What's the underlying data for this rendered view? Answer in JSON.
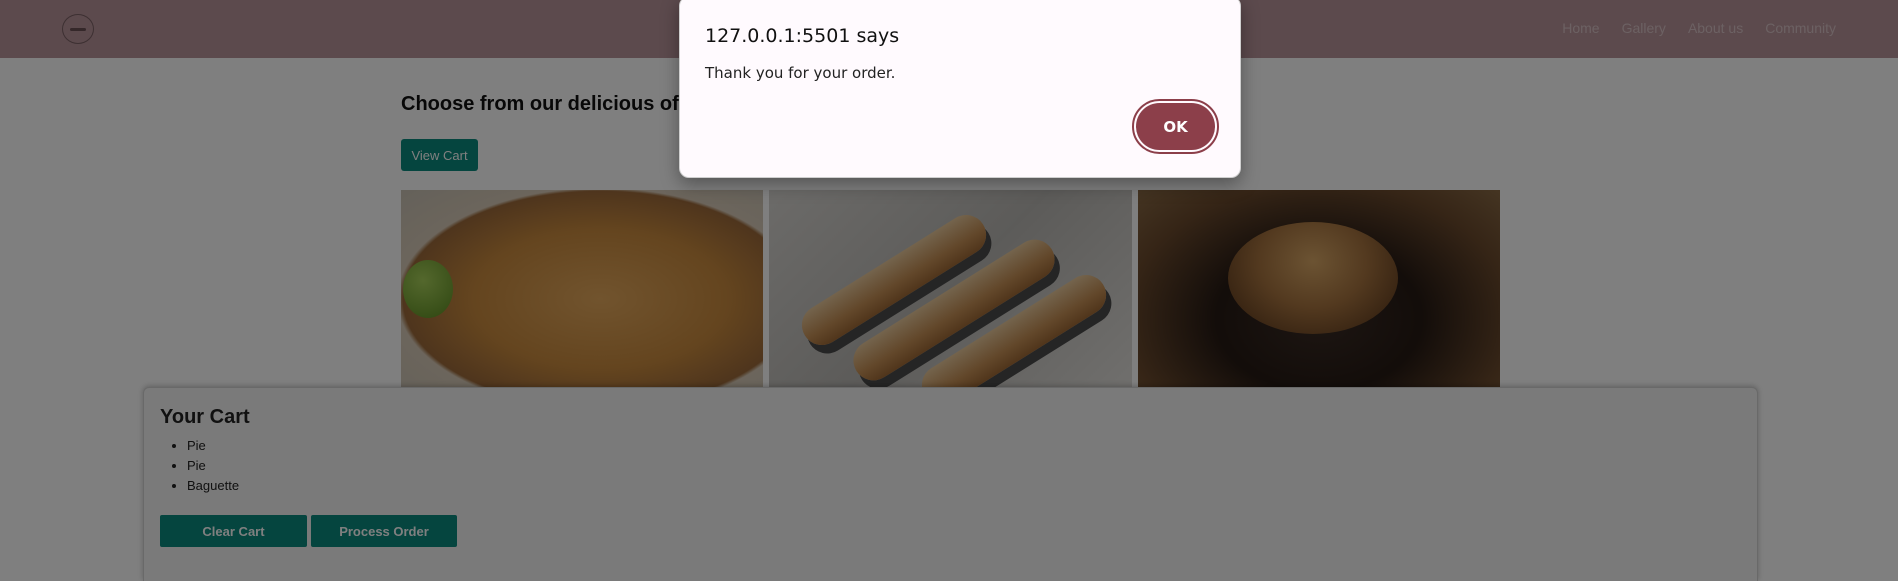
{
  "header": {
    "nav": [
      "Home",
      "Gallery",
      "About us",
      "Community"
    ]
  },
  "main": {
    "title": "Choose from our delicious of",
    "view_cart_label": "View Cart"
  },
  "gallery": {
    "images": [
      "pie-photo",
      "baguette-photo",
      "bread-loaf-photo"
    ]
  },
  "cart": {
    "title": "Your Cart",
    "items": [
      "Pie",
      "Pie",
      "Baguette"
    ],
    "clear_label": "Clear Cart",
    "process_label": "Process Order"
  },
  "dialog": {
    "title": "127.0.0.1:5501 says",
    "message": "Thank you for your order.",
    "ok_label": "OK"
  },
  "colors": {
    "header": "#b8949a",
    "button": "#0a8a7e",
    "ok_button": "#8c3f4a",
    "dialog_bg": "#fffafe"
  }
}
